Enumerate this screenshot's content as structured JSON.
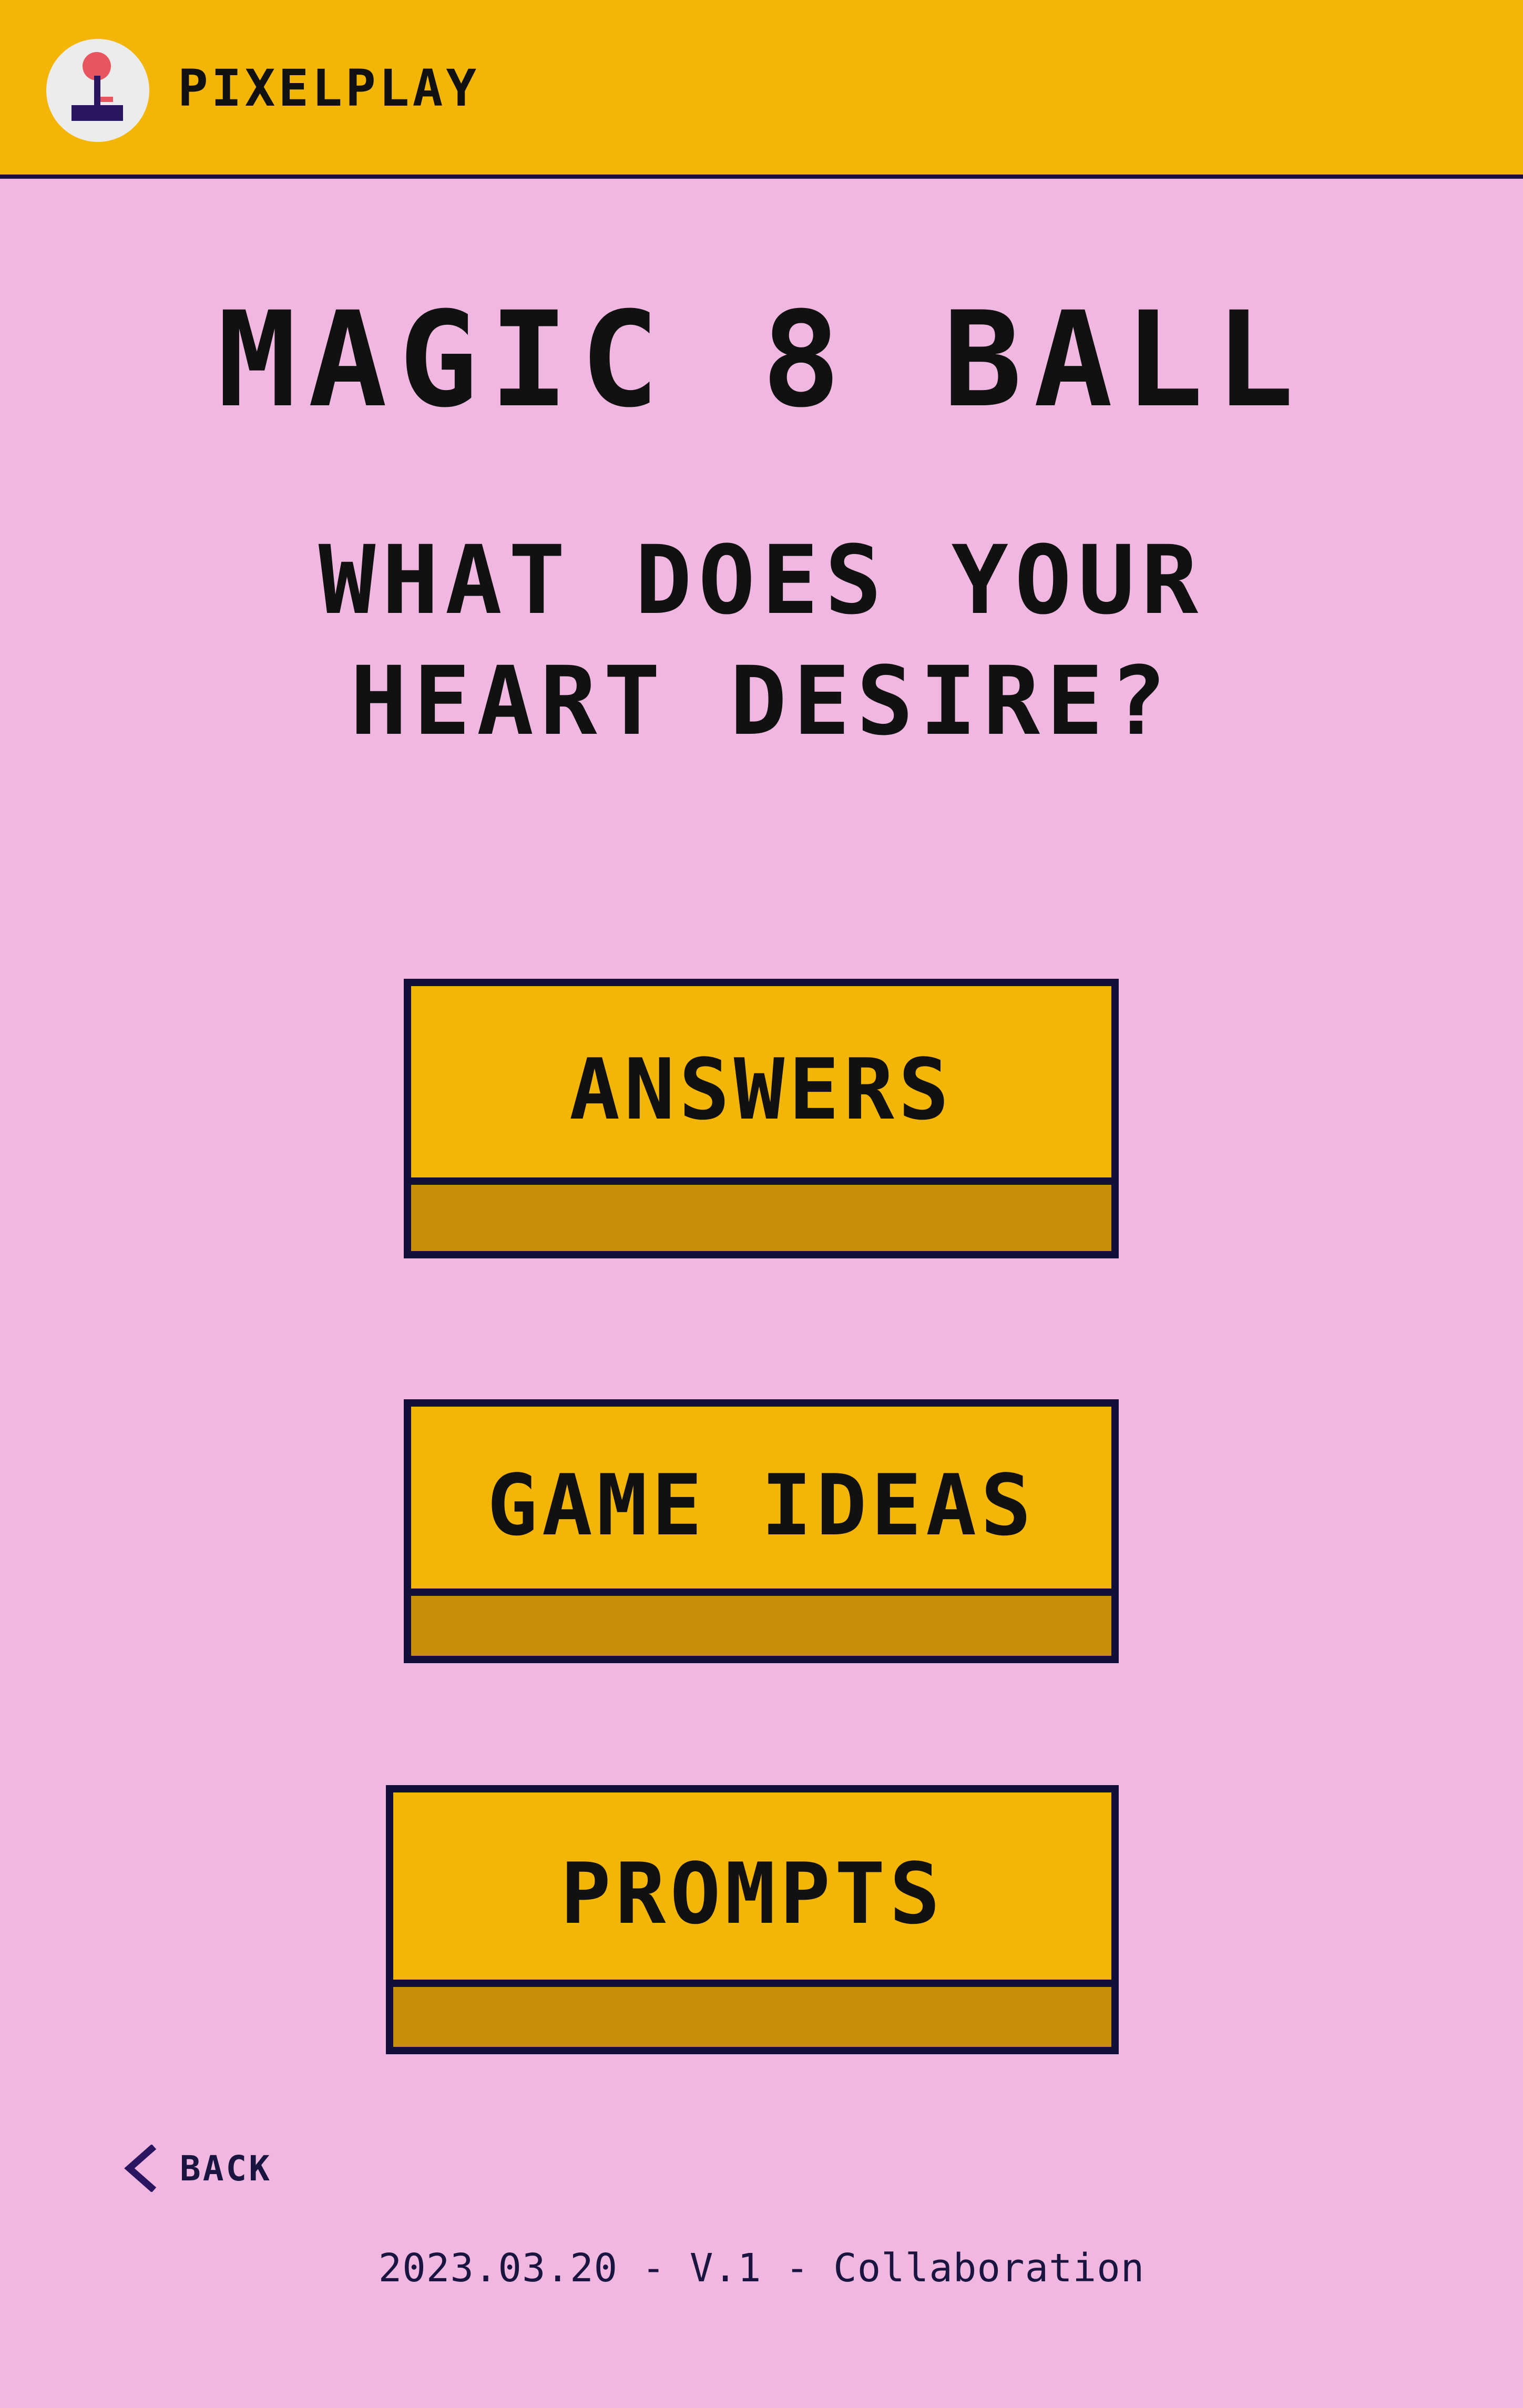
{
  "header": {
    "brand": "PIXELPLAY",
    "logo_icon": "joystick-icon",
    "background_color": "#f4b606"
  },
  "main": {
    "title": "MAGIC 8 BALL",
    "subtitle_line1": "WHAT DOES YOUR",
    "subtitle_line2": "HEART DESIRE?"
  },
  "buttons": [
    {
      "label": "ANSWERS"
    },
    {
      "label": "GAME IDEAS"
    },
    {
      "label": "PROMPTS"
    }
  ],
  "nav": {
    "back_label": "BACK",
    "back_icon": "chevron-left-icon"
  },
  "footer": {
    "text": "2023.03.20 - V.1 - Collaboration"
  },
  "colors": {
    "page_background": "#f0b8e1",
    "button_face": "#f4b606",
    "button_ledge": "#c88e0a",
    "outline": "#120f3a"
  }
}
